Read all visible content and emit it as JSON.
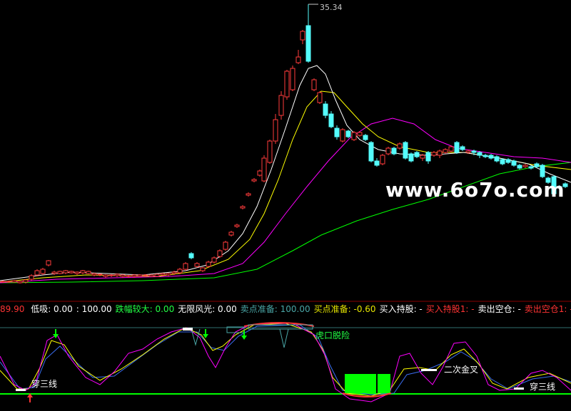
{
  "watermark": "www.6o7o.com",
  "peak_price": "35.34",
  "indicator_bar": {
    "lead_value": "89.90",
    "items": [
      {
        "label": "低吸: 0.00",
        "color": "#ffffff"
      },
      {
        "label": ": 100.00",
        "color": "#ffffff"
      },
      {
        "label": "跌幅较大: 0.00",
        "color": "#22ff44"
      },
      {
        "label": "无限风光: 0.00",
        "color": "#ffffff"
      },
      {
        "label": "卖点准备: 100.00",
        "color": "#4aa6a6"
      },
      {
        "label": "买点准备: -0.60",
        "color": "#e6e600"
      },
      {
        "label": "买入持股: -",
        "color": "#ffffff"
      },
      {
        "label": "买入持股1: -",
        "color": "#ff3333"
      },
      {
        "label": "卖出空仓: -",
        "color": "#ffffff"
      },
      {
        "label": "卖出空仓1: -",
        "color": "#ff3333"
      }
    ]
  },
  "annotations": {
    "tiger_mouth": "虎口脱险",
    "second_golden_cross": "二次金叉",
    "cross_three_lines_left": "穿三线",
    "cross_three_lines_right": "穿三线"
  },
  "colors": {
    "up_candle": "#ff3b3b",
    "down_candle": "#54fcfc",
    "ma_white": "#ffffff",
    "ma_yellow": "#ffff00",
    "ma_magenta": "#ff00ff",
    "ma_green": "#00ff00",
    "buy_arrow": "#00ff00",
    "signal_box": "#00ff00"
  }
}
